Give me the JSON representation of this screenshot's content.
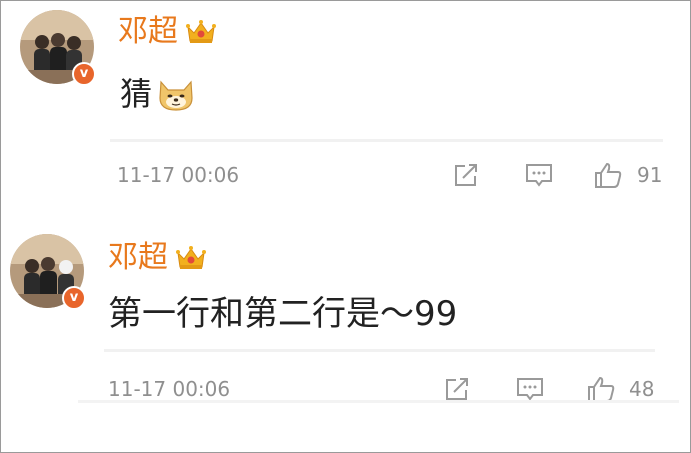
{
  "colors": {
    "username": "#e8791d",
    "verified_badge": "#e8652b",
    "meta_text": "#8f8f8f",
    "icon_stroke": "#9a9a9a"
  },
  "posts": [
    {
      "username": "邓超",
      "username_badge_icon": "crown-icon",
      "verified_badge": "v",
      "content": "猜",
      "emoji_icon": "doge-icon",
      "timestamp": "11-17 00:06",
      "actions": {
        "share_icon": "share-icon",
        "comment_icon": "comment-icon",
        "like_icon": "thumbs-up-icon"
      },
      "like_count": "91"
    },
    {
      "username": "邓超",
      "username_badge_icon": "crown-icon",
      "verified_badge": "v",
      "content": "第一行和第二行是～99",
      "timestamp": "11-17 00:06",
      "actions": {
        "share_icon": "share-icon",
        "comment_icon": "comment-icon",
        "like_icon": "thumbs-up-icon"
      },
      "like_count": "48"
    }
  ]
}
